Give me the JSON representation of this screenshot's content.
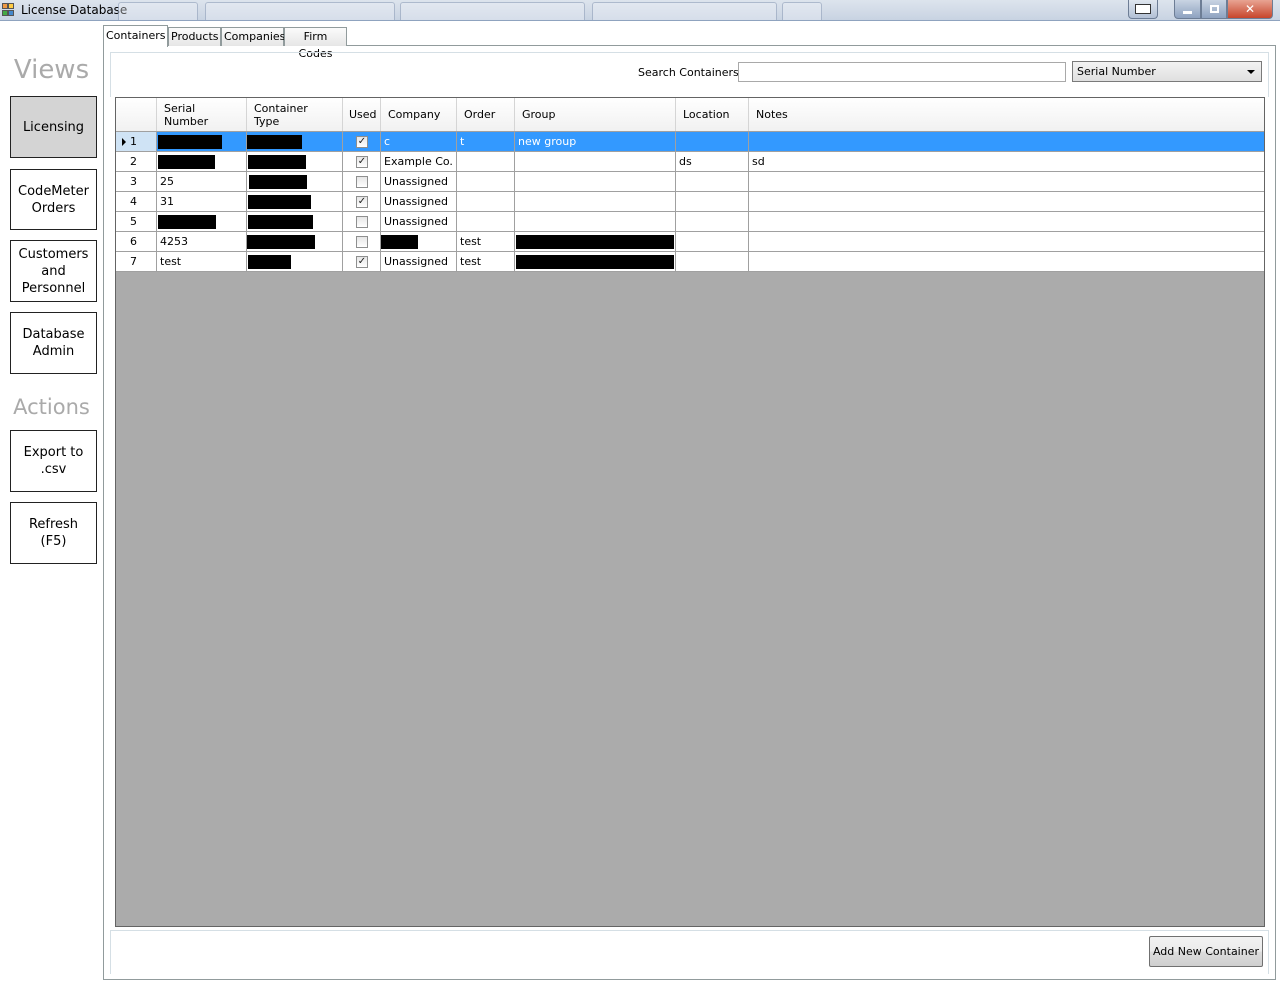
{
  "window": {
    "title": "License Database"
  },
  "sidebar": {
    "views_title": "Views",
    "actions_title": "Actions",
    "nav": [
      {
        "label": "Licensing"
      },
      {
        "label": "CodeMeter Orders"
      },
      {
        "label": "Customers and Personnel"
      },
      {
        "label": "Database Admin"
      }
    ],
    "actions": [
      {
        "label": "Export to .csv"
      },
      {
        "label": "Refresh (F5)"
      }
    ]
  },
  "tabs": [
    {
      "label": "Containers"
    },
    {
      "label": "Products"
    },
    {
      "label": "Companies"
    },
    {
      "label": "Firm Codes"
    }
  ],
  "search": {
    "label": "Search Containers:",
    "value": "",
    "field_selected": "Serial Number"
  },
  "grid": {
    "columns": [
      "Serial Number",
      "Container Type",
      "Used",
      "Company",
      "Order",
      "Group",
      "Location",
      "Notes"
    ],
    "rows": [
      {
        "num": "1",
        "serial": "",
        "type": "",
        "used": true,
        "company": "c",
        "order": "t",
        "group": "new group",
        "location": "",
        "notes": ""
      },
      {
        "num": "2",
        "serial": "",
        "type": "",
        "used": true,
        "company": "Example Co.",
        "order": "",
        "group": "",
        "location": "ds",
        "notes": "sd"
      },
      {
        "num": "3",
        "serial": "25",
        "type": "",
        "used": false,
        "company": "Unassigned",
        "order": "",
        "group": "",
        "location": "",
        "notes": ""
      },
      {
        "num": "4",
        "serial": "31",
        "type": "",
        "used": true,
        "company": "Unassigned",
        "order": "",
        "group": "",
        "location": "",
        "notes": ""
      },
      {
        "num": "5",
        "serial": "",
        "type": "",
        "used": false,
        "company": "Unassigned",
        "order": "",
        "group": "",
        "location": "",
        "notes": ""
      },
      {
        "num": "6",
        "serial": "4253",
        "type": "",
        "used": false,
        "company": "",
        "order": "test",
        "group": "",
        "location": "",
        "notes": ""
      },
      {
        "num": "7",
        "serial": "test",
        "type": "",
        "used": true,
        "company": "Unassigned",
        "order": "test",
        "group": "",
        "location": "",
        "notes": ""
      }
    ]
  },
  "footer": {
    "add_button": "Add New Container"
  },
  "colors": {
    "selection": "#3399ff",
    "grid_background": "#ababab",
    "sidebar_title": "#aaaaaa"
  }
}
